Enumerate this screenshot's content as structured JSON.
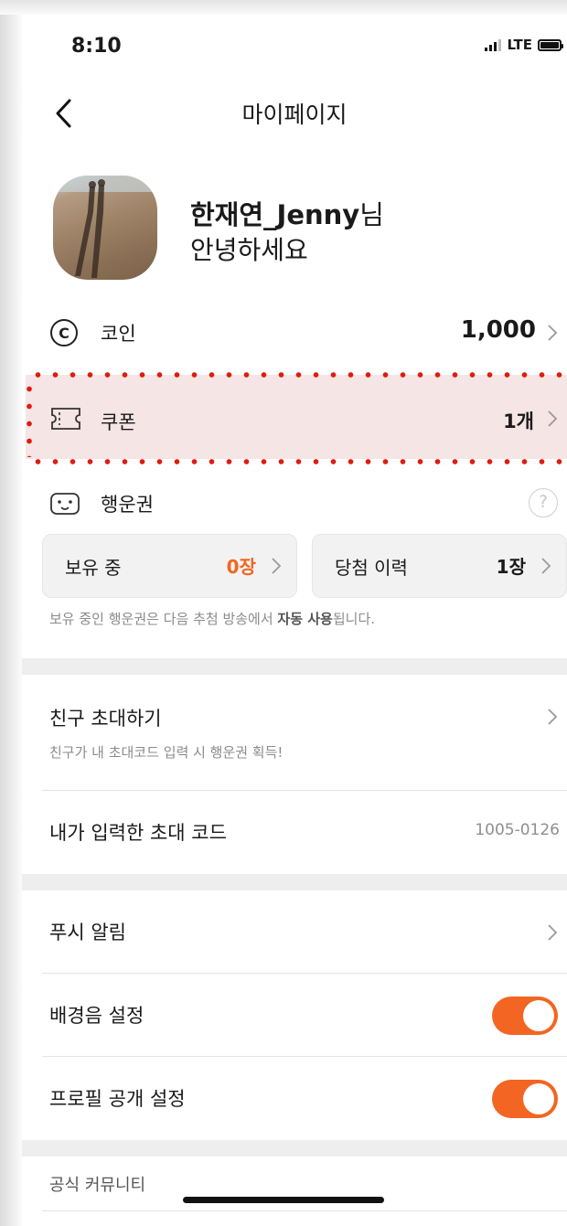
{
  "status_bar": {
    "time": "8:10",
    "network": "LTE",
    "icons": [
      "signal-icon",
      "battery-icon"
    ]
  },
  "nav": {
    "title": "마이페이지",
    "back_icon": "chevron-left-icon"
  },
  "profile": {
    "name": "한재연_Jenny",
    "suffix": "님",
    "greeting": "안녕하세요"
  },
  "coin": {
    "label": "코인",
    "value": "1,000",
    "icon": "coin-icon"
  },
  "coupon": {
    "label": "쿠폰",
    "value": "1개",
    "icon": "ticket-icon"
  },
  "lucky": {
    "label": "행운권",
    "icon": "lucky-ticket-icon",
    "help": "?",
    "holding": {
      "label": "보유 중",
      "value": "0장"
    },
    "won": {
      "label": "당첨 이력",
      "value": "1장"
    },
    "notice_pre": "보유 중인 행운권은 다음 추첨 방송에서 ",
    "notice_bold": "자동 사용",
    "notice_post": "됩니다."
  },
  "invite": {
    "title": "친구 초대하기",
    "subtitle": "친구가 내 초대코드 입력 시 행운권 획득!"
  },
  "entered_code": {
    "label": "내가 입력한 초대 코드",
    "value": "1005-0126"
  },
  "push": {
    "label": "푸시 알림"
  },
  "bgm": {
    "label": "배경음 설정",
    "enabled": true
  },
  "profile_public": {
    "label": "프로필 공개 설정",
    "enabled": true
  },
  "community": {
    "label": "공식 커뮤니티"
  },
  "colors": {
    "accent": "#F26522",
    "highlight": "#F5E5E4",
    "dots": "#E01B0F"
  }
}
